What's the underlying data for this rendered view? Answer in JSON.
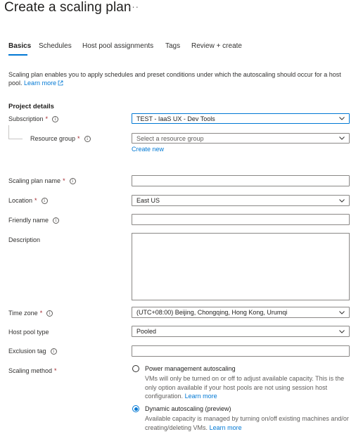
{
  "header": {
    "title": "Create a scaling plan",
    "more": "···"
  },
  "tabs": [
    {
      "label": "Basics",
      "active": true
    },
    {
      "label": "Schedules",
      "active": false
    },
    {
      "label": "Host pool assignments",
      "active": false
    },
    {
      "label": "Tags",
      "active": false
    },
    {
      "label": "Review + create",
      "active": false
    }
  ],
  "intro": {
    "text": "Scaling plan enables you to apply schedules and preset conditions under which the autoscaling should occur for a host pool.",
    "learn_more": "Learn more"
  },
  "project_details": {
    "heading": "Project details",
    "subscription": {
      "label": "Subscription",
      "required": "*",
      "value": "TEST - IaaS UX - Dev Tools"
    },
    "resource_group": {
      "label": "Resource group",
      "required": "*",
      "placeholder": "Select a resource group",
      "create_new": "Create new"
    }
  },
  "form": {
    "name": {
      "label": "Scaling plan name",
      "required": "*",
      "value": ""
    },
    "location": {
      "label": "Location",
      "required": "*",
      "value": "East US"
    },
    "friendly_name": {
      "label": "Friendly name",
      "value": ""
    },
    "description": {
      "label": "Description",
      "value": ""
    },
    "time_zone": {
      "label": "Time zone",
      "required": "*",
      "value": "(UTC+08:00) Beijing, Chongqing, Hong Kong, Urumqi"
    },
    "host_pool_type": {
      "label": "Host pool type",
      "value": "Pooled"
    },
    "exclusion_tag": {
      "label": "Exclusion tag",
      "value": ""
    },
    "scaling_method": {
      "label": "Scaling method",
      "required": "*",
      "options": [
        {
          "title": "Power management autoscaling",
          "description": "VMs will only be turned on or off to adjust available capacity. This is the only option available if your host pools are not using session host configuration.",
          "learn_more": "Learn more",
          "selected": false
        },
        {
          "title": "Dynamic autoscaling (preview)",
          "description": "Available capacity is managed by turning on/off existing machines and/or creating/deleting VMs.",
          "learn_more": "Learn more",
          "selected": true
        }
      ]
    }
  },
  "colors": {
    "accent": "#0078d4",
    "required": "#a4262c",
    "border": "#8a8886",
    "text": "#323130"
  },
  "icons": {
    "info": "info-icon",
    "chevron": "chevron-down-icon",
    "external_link": "external-link-icon"
  }
}
